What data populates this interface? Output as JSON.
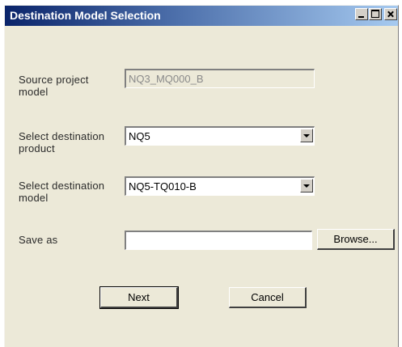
{
  "window": {
    "title": "Destination Model Selection"
  },
  "form": {
    "source_label": "Source project model",
    "source_value": "NQ3_MQ000_B",
    "product_label": "Select destination product",
    "product_value": "NQ5",
    "model_label": "Select destination model",
    "model_value": "NQ5-TQ010-B",
    "save_label": "Save as",
    "save_value": "",
    "browse_label": "Browse..."
  },
  "buttons": {
    "next_label": "Next",
    "cancel_label": "Cancel"
  },
  "colors": {
    "title_gradient_start": "#0a246a",
    "title_gradient_end": "#a6caf0",
    "dialog_bg": "#ece9d8"
  }
}
